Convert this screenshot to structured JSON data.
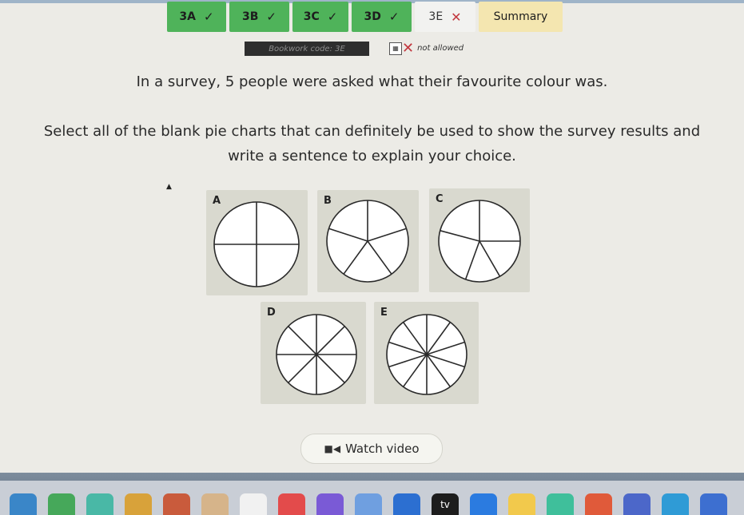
{
  "tabs": [
    {
      "label": "3A",
      "status": "✓"
    },
    {
      "label": "3B",
      "status": "✓"
    },
    {
      "label": "3C",
      "status": "✓"
    },
    {
      "label": "3D",
      "status": "✓"
    },
    {
      "label": "3E",
      "status": "✕"
    },
    {
      "label": "Summary"
    }
  ],
  "bookwork": {
    "label": "Bookwork code: 3E"
  },
  "calculator": {
    "label": "not allowed",
    "icon": "calculator-icon"
  },
  "question": {
    "line1": "In a survey, 5 people were asked what their favourite colour was.",
    "line2": "Select all of the blank pie charts that can definitely be used to show the survey results and write a sentence to explain your choice."
  },
  "charts": [
    {
      "label": "A",
      "sectors": 4,
      "kind": "equal"
    },
    {
      "label": "B",
      "sectors": 5,
      "kind": "equal"
    },
    {
      "label": "C",
      "sectors": 5,
      "kind": "unequal"
    },
    {
      "label": "D",
      "sectors": 8,
      "kind": "equal"
    },
    {
      "label": "E",
      "sectors": 10,
      "kind": "equal"
    }
  ],
  "video": {
    "label": "Watch video",
    "icon": "video-camera-icon"
  },
  "dock": {
    "tv_label": "tv",
    "colors": [
      "#3a86c8",
      "#46a85a",
      "#49b8a6",
      "#d8a23a",
      "#c95b3c",
      "#d6b48a",
      "#f1f1f1",
      "#e34b4b",
      "#7a5ad6",
      "#6f9fe0",
      "#2c6fd1",
      "#1d1d1d",
      "#2b7be0",
      "#f2c94c",
      "#3fbf9b",
      "#e05a3a",
      "#4c67c9",
      "#2f9bd6",
      "#3d6fd0"
    ]
  }
}
